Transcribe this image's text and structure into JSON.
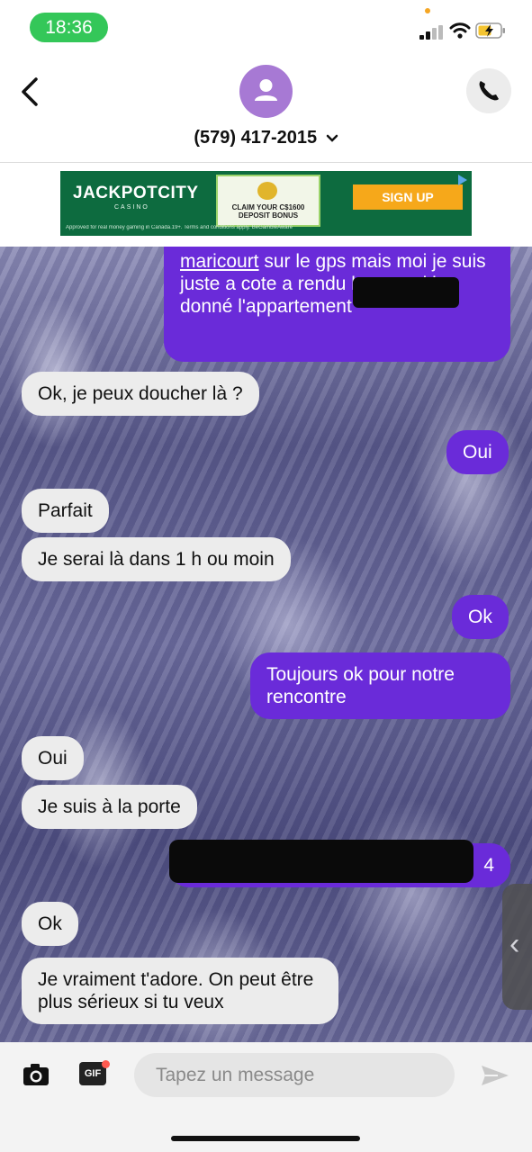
{
  "status_bar": {
    "time": "18:36"
  },
  "header": {
    "contact_name": "(579) 417-2015"
  },
  "ad": {
    "brand": "JACKPOTCITY",
    "brand_sub": "CASINO",
    "offer": "CLAIM YOUR C$1600 DEPOSIT BONUS",
    "button": "SIGN UP",
    "fine_print": "Approved for real money gaming in Canada.19+. Terms and conditions apply. BeGambleAware"
  },
  "messages": [
    {
      "dir": "out",
      "parts": [
        "maricourt",
        " sur le gps mais moi je suis juste a cote a",
        "rendu la txt moi jte donné l'appartement"
      ]
    },
    {
      "dir": "in",
      "text": "Ok, je peux doucher là ?"
    },
    {
      "dir": "out",
      "text": "Oui"
    },
    {
      "dir": "in",
      "text": "Parfait"
    },
    {
      "dir": "in",
      "text": "Je serai là dans 1 h ou moin"
    },
    {
      "dir": "out",
      "text": "Ok"
    },
    {
      "dir": "out",
      "text": "Toujours ok pour notre rencontre"
    },
    {
      "dir": "in",
      "text": "Oui"
    },
    {
      "dir": "in",
      "text": "Je suis à la porte"
    },
    {
      "dir": "out",
      "text": "4"
    },
    {
      "dir": "in",
      "text": "Ok"
    },
    {
      "dir": "in",
      "text": "Je vraiment t'adore. On peut être plus sérieux si tu veux"
    }
  ],
  "composer": {
    "placeholder": "Tapez un message",
    "gif_label": "GIF"
  },
  "icons": {
    "back": "chevron-left-icon",
    "avatar": "person-icon",
    "call": "phone-icon",
    "camera": "camera-icon",
    "send": "send-icon",
    "drawer": "chevron-left-icon"
  },
  "colors": {
    "outgoing": "#6a2bd9",
    "incoming": "#ececec",
    "avatar": "#a779d4",
    "time_pill": "#34c759"
  }
}
